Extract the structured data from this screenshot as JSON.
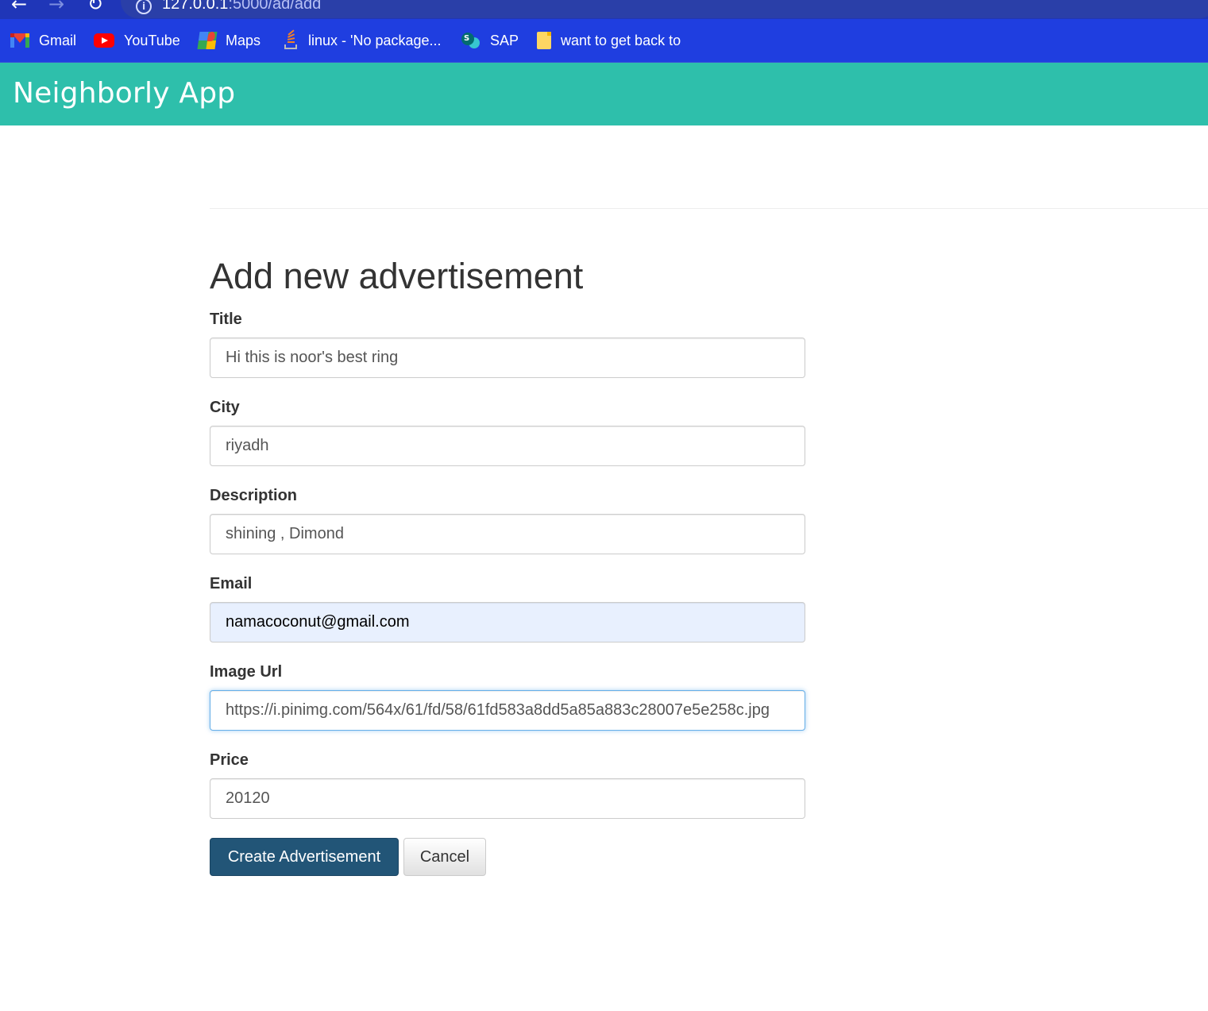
{
  "browser": {
    "url_host": "127.0.0.1",
    "url_path": ":5000/ad/add",
    "back_icon": "←",
    "forward_icon": "→",
    "reload_icon": "↻",
    "info_icon": "i",
    "bookmarks": [
      {
        "label": "Gmail",
        "icon": "gmail-icon"
      },
      {
        "label": "YouTube",
        "icon": "youtube-icon"
      },
      {
        "label": "Maps",
        "icon": "maps-icon"
      },
      {
        "label": "linux - 'No package...",
        "icon": "stackoverflow-icon"
      },
      {
        "label": "SAP",
        "icon": "sharepoint-icon"
      },
      {
        "label": "want to get back to",
        "icon": "folder-icon"
      }
    ]
  },
  "app": {
    "brand": "Neighborly App",
    "header_color": "#2ebfab"
  },
  "form": {
    "title": "Add new advertisement",
    "fields": {
      "title": {
        "label": "Title",
        "value": "Hi this is noor's best ring"
      },
      "city": {
        "label": "City",
        "value": "riyadh"
      },
      "description": {
        "label": "Description",
        "value": "shining , Dimond"
      },
      "email": {
        "label": "Email",
        "value": "namacoconut@gmail.com"
      },
      "image_url": {
        "label": "Image Url",
        "value": "https://i.pinimg.com/564x/61/fd/58/61fd583a8dd5a85a883c28007e5e258c.jpg"
      },
      "price": {
        "label": "Price",
        "value": "20120"
      }
    },
    "submit_label": "Create Advertisement",
    "cancel_label": "Cancel"
  },
  "colors": {
    "primary_button": "#225577",
    "bookmarks_bar": "#1f3ee0",
    "autofill_background": "#e8f0fe"
  }
}
